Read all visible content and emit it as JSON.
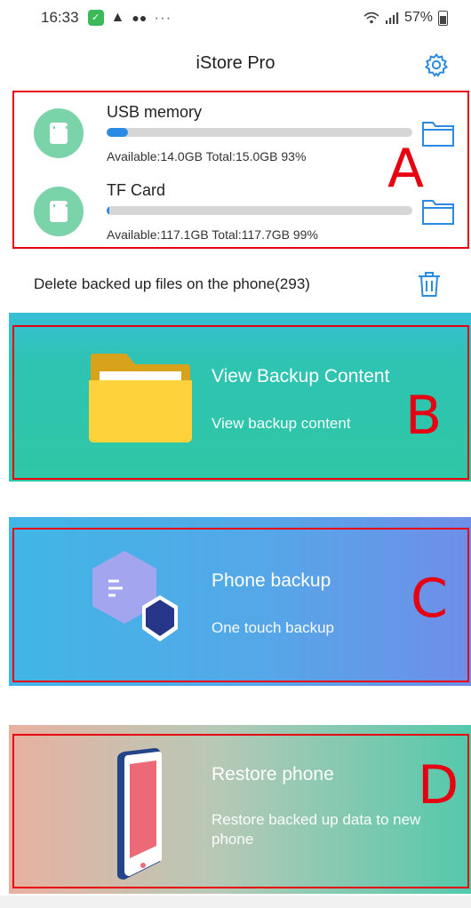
{
  "status_bar": {
    "time": "16:33",
    "more": "···",
    "battery": "57%",
    "icons": [
      "app-notification-icon",
      "warning-icon",
      "wechat-icon",
      "wifi-icon",
      "signal-icon",
      "battery-icon"
    ]
  },
  "header": {
    "title": "iStore Pro",
    "settings_icon": "gear-icon"
  },
  "storage": {
    "items": [
      {
        "name": "USB memory",
        "info": "Available:14.0GB Total:15.0GB  93%",
        "used_fraction": 0.07
      },
      {
        "name": "TF Card",
        "info": "Available:117.1GB Total:117.7GB  99%",
        "used_fraction": 0.01
      }
    ]
  },
  "delete_row": {
    "text": "Delete backed up files on the phone(293)"
  },
  "cards": {
    "view_backup": {
      "title": "View Backup Content",
      "subtitle": "View backup content"
    },
    "phone_backup": {
      "title": "Phone backup",
      "subtitle": "One touch backup"
    },
    "restore": {
      "title": "Restore phone",
      "subtitle": "Restore backed up data to new phone"
    }
  },
  "annotations": {
    "a": "A",
    "b": "B",
    "c": "C",
    "d": "D"
  },
  "colors": {
    "annotation_red": "#e60012",
    "accent_blue": "#2b8ae2",
    "sd_green": "#7bd3a9"
  }
}
